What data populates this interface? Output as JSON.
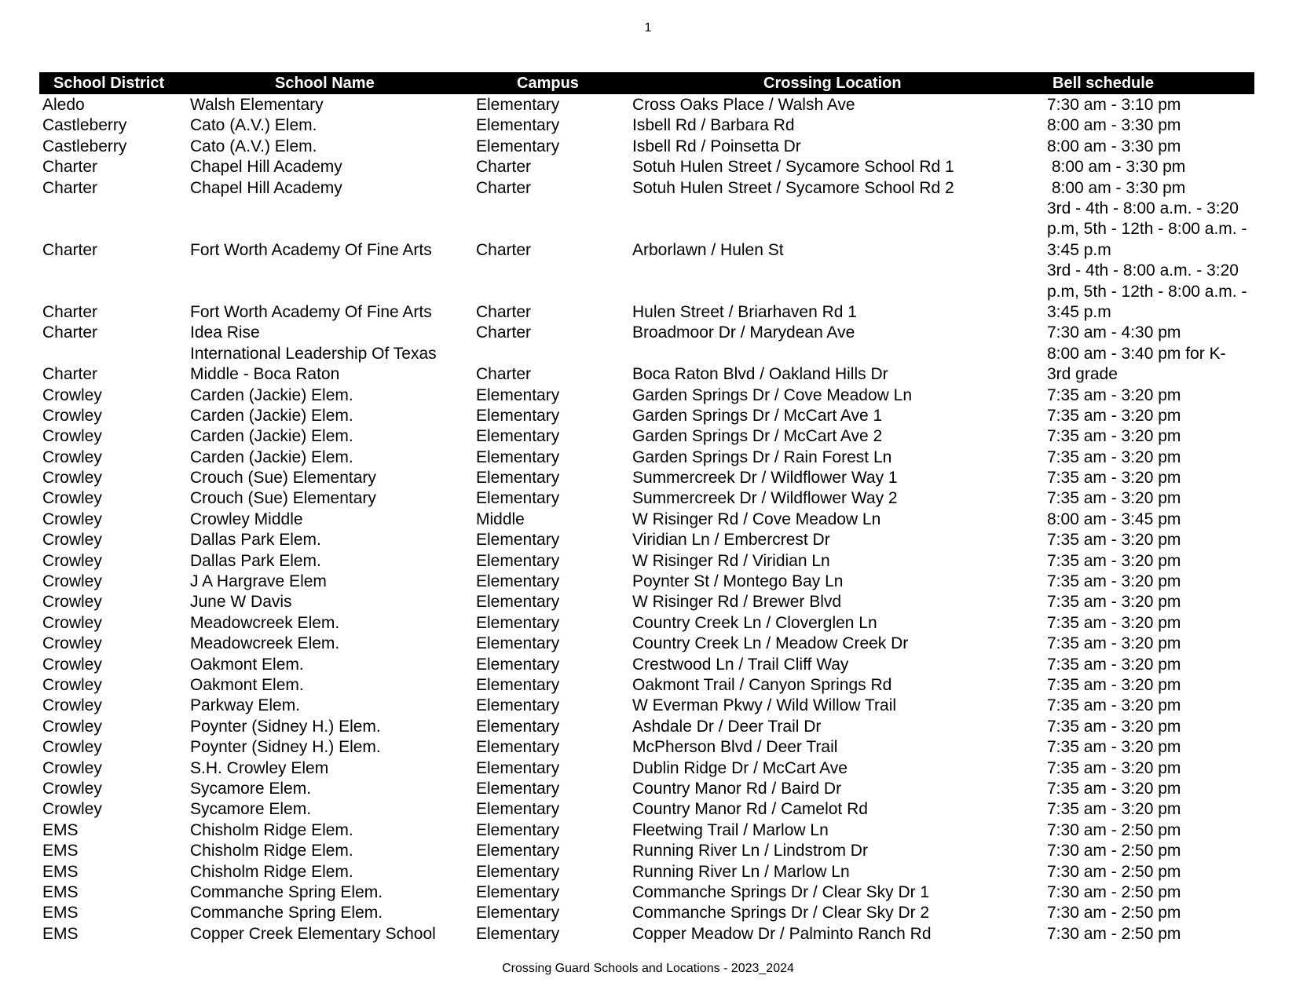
{
  "page_number": "1",
  "header": {
    "district": "School District",
    "school": "School Name",
    "campus": "Campus",
    "crossing": "Crossing Location",
    "bell": "Bell schedule"
  },
  "rows": [
    {
      "district": "Aledo",
      "school": "Walsh Elementary",
      "campus": "Elementary",
      "crossing": "Cross Oaks Place / Walsh Ave",
      "bell": [
        "7:30 am - 3:10 pm"
      ]
    },
    {
      "district": "Castleberry",
      "school": "Cato (A.V.) Elem.",
      "campus": "Elementary",
      "crossing": "Isbell Rd / Barbara Rd",
      "bell": [
        "8:00 am - 3:30 pm"
      ]
    },
    {
      "district": "Castleberry",
      "school": "Cato (A.V.) Elem.",
      "campus": "Elementary",
      "crossing": "Isbell Rd / Poinsetta Dr",
      "bell": [
        "8:00 am - 3:30 pm"
      ]
    },
    {
      "district": "Charter",
      "school": "Chapel Hill Academy",
      "campus": "Charter",
      "crossing": "Sotuh Hulen Street / Sycamore School Rd 1",
      "bell": [
        " 8:00 am - 3:30 pm"
      ]
    },
    {
      "district": "Charter",
      "school": "Chapel Hill Academy",
      "campus": "Charter",
      "crossing": "Sotuh Hulen Street / Sycamore School Rd 2",
      "bell": [
        " 8:00 am - 3:30 pm"
      ]
    },
    {
      "district": "Charter",
      "school": "Fort Worth Academy Of Fine Arts",
      "campus": "Charter",
      "crossing": "Arborlawn / Hulen St",
      "bell": [
        "3rd - 4th - 8:00 a.m. - 3:20",
        "p.m, 5th - 12th - 8:00 a.m. -",
        "3:45 p.m"
      ]
    },
    {
      "district": "Charter",
      "school": "Fort Worth Academy Of Fine Arts",
      "campus": "Charter",
      "crossing": "Hulen Street / Briarhaven Rd 1",
      "bell": [
        "3rd - 4th - 8:00 a.m. - 3:20",
        "p.m, 5th - 12th - 8:00 a.m. -",
        "3:45 p.m"
      ]
    },
    {
      "district": "Charter",
      "school": "Idea Rise",
      "campus": "Charter",
      "crossing": "Broadmoor Dr / Marydean Ave",
      "bell": [
        "7:30 am - 4:30 pm"
      ]
    },
    {
      "district": "Charter",
      "school": "International Leadership Of Texas|Middle - Boca Raton",
      "campus": "Charter",
      "crossing": "Boca Raton Blvd / Oakland Hills Dr",
      "bell": [
        "8:00 am - 3:40 pm for K-",
        "3rd grade"
      ]
    },
    {
      "district": "Crowley",
      "school": "Carden (Jackie) Elem.",
      "campus": "Elementary",
      "crossing": "Garden Springs Dr / Cove Meadow Ln",
      "bell": [
        "7:35 am - 3:20 pm"
      ]
    },
    {
      "district": "Crowley",
      "school": "Carden (Jackie) Elem.",
      "campus": "Elementary",
      "crossing": "Garden Springs Dr / McCart Ave 1",
      "bell": [
        "7:35 am - 3:20 pm"
      ]
    },
    {
      "district": "Crowley",
      "school": "Carden (Jackie) Elem.",
      "campus": "Elementary",
      "crossing": "Garden Springs Dr / McCart Ave 2",
      "bell": [
        "7:35 am - 3:20 pm"
      ]
    },
    {
      "district": "Crowley",
      "school": "Carden (Jackie) Elem.",
      "campus": "Elementary",
      "crossing": "Garden Springs Dr / Rain Forest Ln",
      "bell": [
        "7:35 am - 3:20 pm"
      ]
    },
    {
      "district": "Crowley",
      "school": "Crouch (Sue) Elementary",
      "campus": "Elementary",
      "crossing": "Summercreek Dr / Wildflower Way 1",
      "bell": [
        "7:35 am - 3:20 pm"
      ]
    },
    {
      "district": "Crowley",
      "school": "Crouch (Sue) Elementary",
      "campus": "Elementary",
      "crossing": "Summercreek Dr / Wildflower Way 2",
      "bell": [
        "7:35 am - 3:20 pm"
      ]
    },
    {
      "district": "Crowley",
      "school": "Crowley Middle",
      "campus": "Middle",
      "crossing": "W Risinger Rd / Cove Meadow Ln",
      "bell": [
        "8:00 am - 3:45 pm"
      ]
    },
    {
      "district": "Crowley",
      "school": "Dallas Park Elem.",
      "campus": "Elementary",
      "crossing": "Viridian Ln / Embercrest Dr",
      "bell": [
        "7:35 am - 3:20 pm"
      ]
    },
    {
      "district": "Crowley",
      "school": "Dallas Park Elem.",
      "campus": "Elementary",
      "crossing": "W Risinger Rd / Viridian Ln",
      "bell": [
        "7:35 am - 3:20 pm"
      ]
    },
    {
      "district": "Crowley",
      "school": "J A Hargrave Elem",
      "campus": "Elementary",
      "crossing": "Poynter St / Montego Bay Ln",
      "bell": [
        "7:35 am - 3:20 pm"
      ]
    },
    {
      "district": "Crowley",
      "school": "June W Davis",
      "campus": "Elementary",
      "crossing": "W Risinger Rd / Brewer Blvd",
      "bell": [
        "7:35 am - 3:20 pm"
      ]
    },
    {
      "district": "Crowley",
      "school": "Meadowcreek Elem.",
      "campus": "Elementary",
      "crossing": "Country Creek Ln / Cloverglen Ln",
      "bell": [
        "7:35 am - 3:20 pm"
      ]
    },
    {
      "district": "Crowley",
      "school": "Meadowcreek Elem.",
      "campus": "Elementary",
      "crossing": "Country Creek Ln / Meadow Creek Dr",
      "bell": [
        "7:35 am - 3:20 pm"
      ]
    },
    {
      "district": "Crowley",
      "school": "Oakmont Elem.",
      "campus": "Elementary",
      "crossing": "Crestwood Ln / Trail Cliff Way",
      "bell": [
        "7:35 am - 3:20 pm"
      ]
    },
    {
      "district": "Crowley",
      "school": "Oakmont Elem.",
      "campus": "Elementary",
      "crossing": "Oakmont Trail / Canyon Springs Rd",
      "bell": [
        "7:35 am - 3:20 pm"
      ]
    },
    {
      "district": "Crowley",
      "school": "Parkway Elem.",
      "campus": "Elementary",
      "crossing": "W Everman Pkwy / Wild Willow Trail",
      "bell": [
        "7:35 am - 3:20 pm"
      ]
    },
    {
      "district": "Crowley",
      "school": "Poynter (Sidney H.) Elem.",
      "campus": "Elementary",
      "crossing": "Ashdale Dr / Deer Trail Dr",
      "bell": [
        "7:35 am - 3:20 pm"
      ]
    },
    {
      "district": "Crowley",
      "school": "Poynter (Sidney H.) Elem.",
      "campus": "Elementary",
      "crossing": "McPherson Blvd / Deer Trail",
      "bell": [
        "7:35 am - 3:20 pm"
      ]
    },
    {
      "district": "Crowley",
      "school": "S.H. Crowley Elem",
      "campus": "Elementary",
      "crossing": "Dublin Ridge Dr / McCart Ave",
      "bell": [
        "7:35 am - 3:20 pm"
      ]
    },
    {
      "district": "Crowley",
      "school": "Sycamore Elem.",
      "campus": "Elementary",
      "crossing": "Country Manor Rd / Baird Dr",
      "bell": [
        "7:35 am - 3:20 pm"
      ]
    },
    {
      "district": "Crowley",
      "school": "Sycamore Elem.",
      "campus": "Elementary",
      "crossing": "Country Manor Rd / Camelot Rd",
      "bell": [
        "7:35 am - 3:20 pm"
      ]
    },
    {
      "district": "EMS",
      "school": "Chisholm Ridge Elem.",
      "campus": "Elementary",
      "crossing": "Fleetwing Trail / Marlow Ln",
      "bell": [
        "7:30 am - 2:50 pm"
      ]
    },
    {
      "district": "EMS",
      "school": "Chisholm Ridge Elem.",
      "campus": "Elementary",
      "crossing": "Running River Ln / Lindstrom Dr",
      "bell": [
        "7:30 am - 2:50 pm"
      ]
    },
    {
      "district": "EMS",
      "school": "Chisholm Ridge Elem.",
      "campus": "Elementary",
      "crossing": "Running River Ln / Marlow Ln",
      "bell": [
        "7:30 am - 2:50 pm"
      ]
    },
    {
      "district": "EMS",
      "school": "Commanche Spring Elem.",
      "campus": "Elementary",
      "crossing": "Commanche Springs Dr / Clear Sky Dr 1",
      "bell": [
        "7:30 am - 2:50 pm"
      ]
    },
    {
      "district": "EMS",
      "school": "Commanche Spring Elem.",
      "campus": "Elementary",
      "crossing": "Commanche Springs Dr / Clear Sky Dr 2",
      "bell": [
        "7:30 am - 2:50 pm"
      ]
    },
    {
      "district": "EMS",
      "school": "Copper Creek Elementary School",
      "campus": "Elementary",
      "crossing": "Copper Meadow Dr / Palminto Ranch Rd",
      "bell": [
        "7:30 am - 2:50 pm"
      ]
    }
  ],
  "footer": "Crossing Guard Schools and Locations - 2023_2024"
}
